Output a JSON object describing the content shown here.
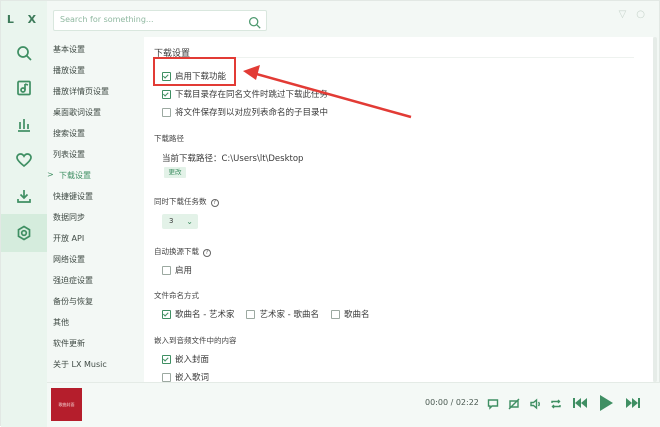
{
  "app": {
    "logo": "L X"
  },
  "rail": {
    "items": [
      {
        "name": "search-icon"
      },
      {
        "name": "music-note-icon"
      },
      {
        "name": "chart-icon"
      },
      {
        "name": "heart-icon"
      },
      {
        "name": "download-icon"
      },
      {
        "name": "settings-icon",
        "active": true
      }
    ]
  },
  "search": {
    "placeholder": "Search for something..."
  },
  "window": {
    "minimize": "▽",
    "close": "○"
  },
  "menu": {
    "items": [
      "基本设置",
      "播放设置",
      "播放详情页设置",
      "桌面歌词设置",
      "搜索设置",
      "列表设置",
      "下载设置",
      "快捷键设置",
      "数据同步",
      "开放 API",
      "网络设置",
      "强迫症设置",
      "备份与恢复",
      "其他",
      "软件更新",
      "关于 LX Music"
    ],
    "active_index": 6,
    "active_arrow": ">"
  },
  "download": {
    "section_title": "下载设置",
    "enable_label": "启用下载功能",
    "skip_label": "下载目录存在同名文件时跳过下载此任务",
    "subdir_label": "将文件保存到以对应列表命名的子目录中",
    "path_title": "下载路径",
    "path_text": "当前下载路径：C:\\Users\\lt\\Desktop",
    "change_button": "更改",
    "concurrent_title": "同时下载任务数",
    "concurrent_value": "3",
    "lyric_title": "自动换源下载",
    "lyric_enable": "启用",
    "naming_title": "文件命名方式",
    "naming_options": [
      "歌曲名 - 艺术家",
      "艺术家 - 歌曲名",
      "歌曲名"
    ],
    "embed_title": "嵌入到音频文件中的内容",
    "embed_cover": "嵌入封面",
    "embed_lyric": "嵌入歌词"
  },
  "player": {
    "cover_text": "歌曲封面",
    "time": "00:00 / 02:22"
  },
  "colors": {
    "accent": "#3f8f63",
    "highlight": "#e23b35"
  }
}
